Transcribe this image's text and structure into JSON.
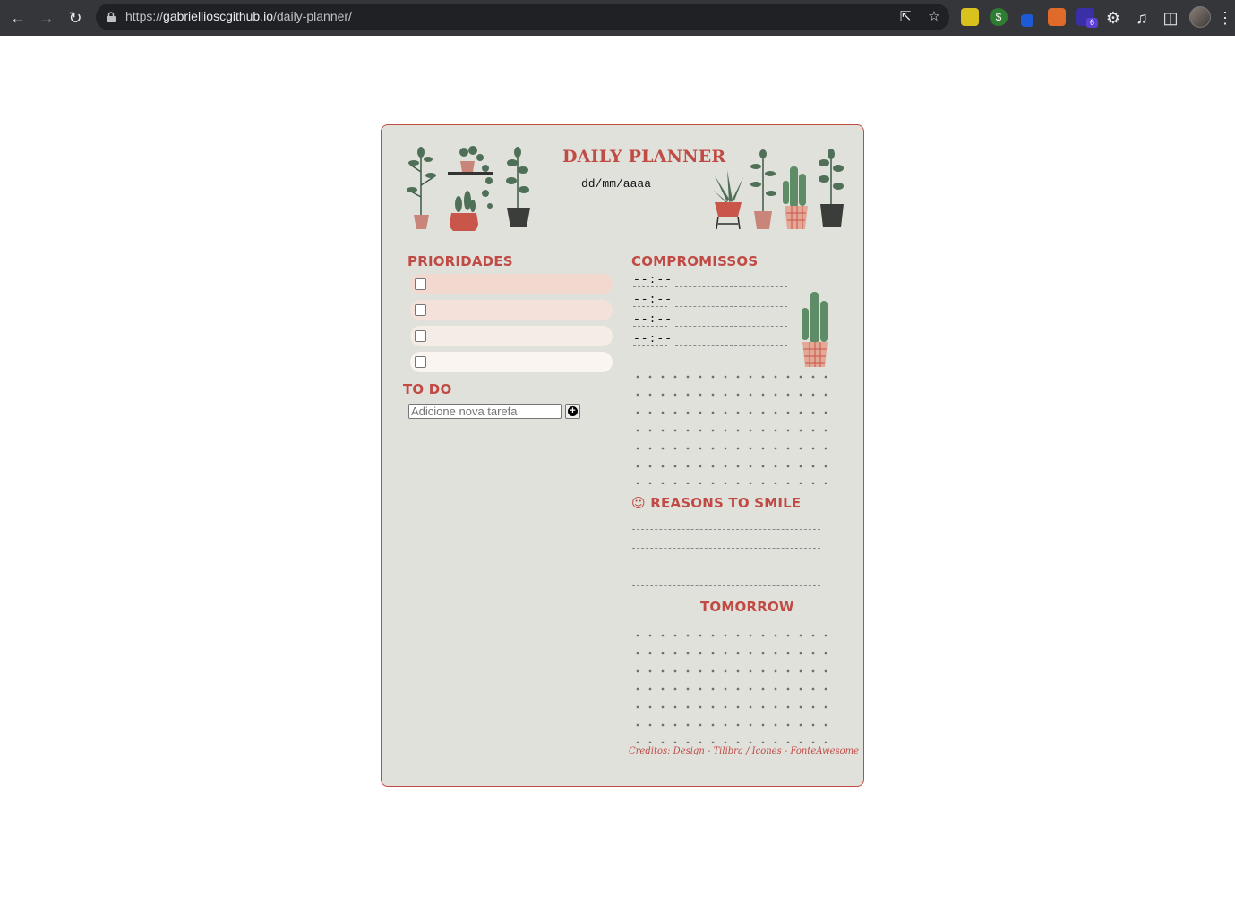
{
  "browser": {
    "url_scheme": "https://",
    "url_host": "gabriellioscgithub.io",
    "url_host_display": "gabriellioscgithub.io",
    "url_path": "/daily-planner/"
  },
  "planner": {
    "title": "DAILY PLANNER",
    "date_placeholder": "dd/mm/aaaa",
    "priorities_heading": "PRIORIDADES",
    "priority_colors": [
      "#f2d8cf",
      "#f4e2da",
      "#f5ece6",
      "#faf5f0"
    ],
    "todo_heading": "TO DO",
    "todo_placeholder": "Adicione nova tarefa",
    "appointments_heading": "COMPROMISSOS",
    "time_placeholder": "--:--",
    "reasons_heading": "☺ REASONS TO SMILE",
    "tomorrow_heading": "TOMORROW",
    "credits": "Creditos: Design - Tilibra / Icones - FonteAwesome",
    "accent_color": "#c04a44",
    "background_color": "#e1e1dc"
  }
}
